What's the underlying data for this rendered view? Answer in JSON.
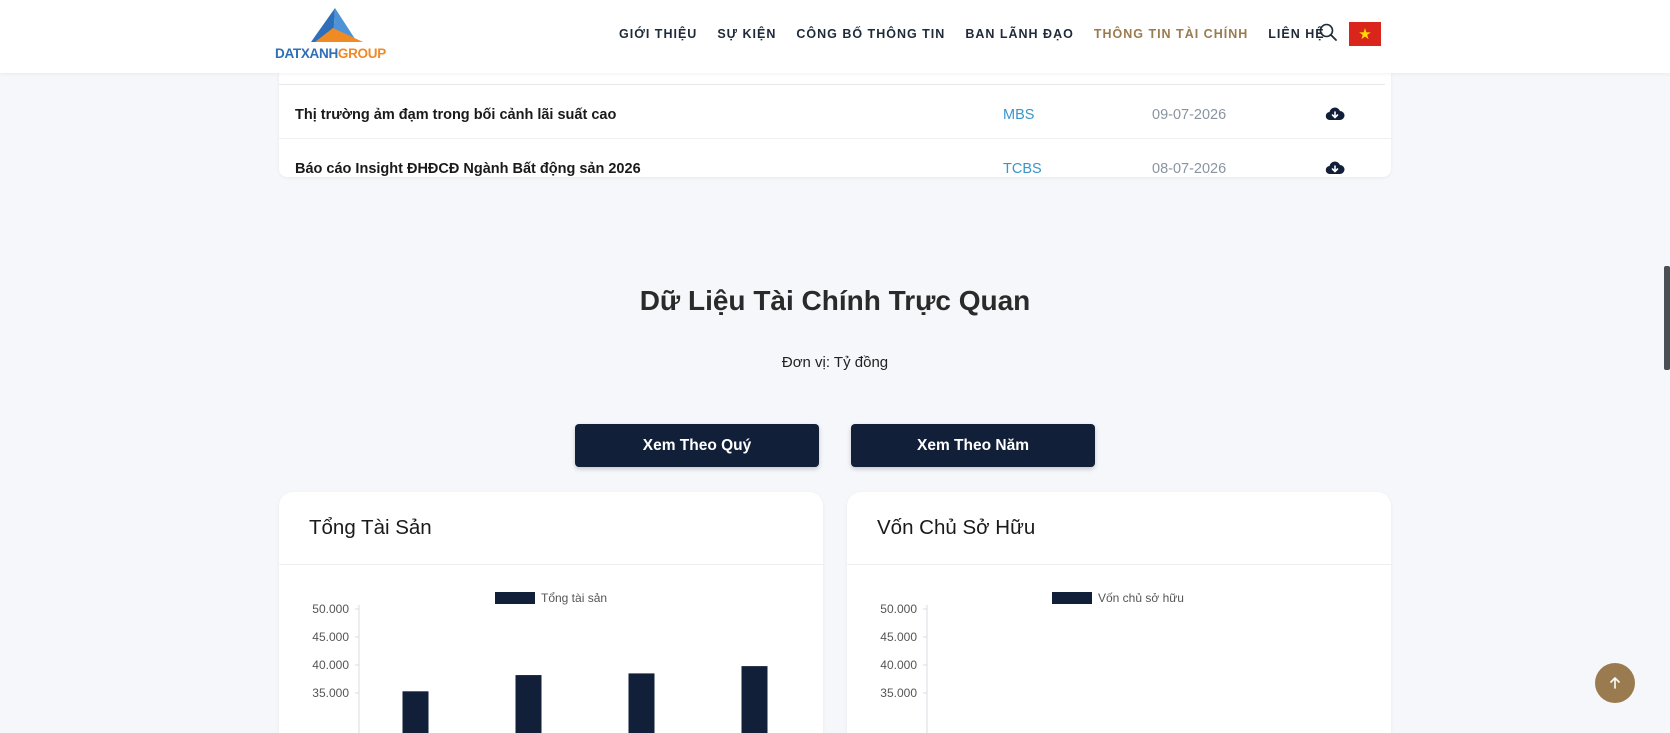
{
  "brand": {
    "name_part1": "DATXANH",
    "name_part2": "GROUP"
  },
  "nav": {
    "items": [
      {
        "label": "GIỚI THIỆU",
        "active": false
      },
      {
        "label": "SỰ KIỆN",
        "active": false
      },
      {
        "label": "CÔNG BỐ THÔNG TIN",
        "active": false
      },
      {
        "label": "BAN LÃNH ĐẠO",
        "active": false
      },
      {
        "label": "THÔNG TIN TÀI CHÍNH",
        "active": true
      },
      {
        "label": "LIÊN HỆ",
        "active": false
      }
    ],
    "search_icon": "search-icon",
    "language_flag": "vietnam-flag-icon"
  },
  "documents": {
    "rows": [
      {
        "title": "Thị trường ảm đạm trong bối cảnh lãi suất cao",
        "source": "MBS",
        "date": "09-07-2026",
        "icon": "cloud-download-icon"
      },
      {
        "title": "Báo cáo Insight ĐHĐCĐ Ngành Bất động sản 2026",
        "source": "TCBS",
        "date": "08-07-2026",
        "icon": "cloud-download-icon"
      }
    ]
  },
  "financial": {
    "title": "Dữ Liệu Tài Chính Trực Quan",
    "unit": "Đơn vị: Tỷ đồng",
    "btn_quarter": "Xem Theo Quý",
    "btn_year": "Xem Theo Năm"
  },
  "colors": {
    "bar": "#111f38",
    "accent": "#9a7b4f",
    "link": "#3a95c9"
  },
  "chart_data": [
    {
      "type": "bar",
      "title": "Tổng Tài Sản",
      "series": [
        {
          "name": "Tổng tài sản",
          "values": [
            35300,
            38200,
            38500,
            39800
          ]
        }
      ],
      "yticks": [
        "50.000",
        "45.000",
        "40.000",
        "35.000"
      ],
      "ytick_values": [
        50000,
        45000,
        40000,
        35000
      ],
      "ylim": [
        30000,
        50000
      ],
      "legend": "top-center"
    },
    {
      "type": "bar",
      "title": "Vốn Chủ Sở Hữu",
      "series": [
        {
          "name": "Vốn chủ sở hữu",
          "values": []
        }
      ],
      "yticks": [
        "50.000",
        "45.000",
        "40.000",
        "35.000"
      ],
      "ytick_values": [
        50000,
        45000,
        40000,
        35000
      ],
      "ylim": [
        30000,
        50000
      ],
      "legend": "top-center"
    }
  ],
  "scroll_top_icon": "arrow-up-icon"
}
